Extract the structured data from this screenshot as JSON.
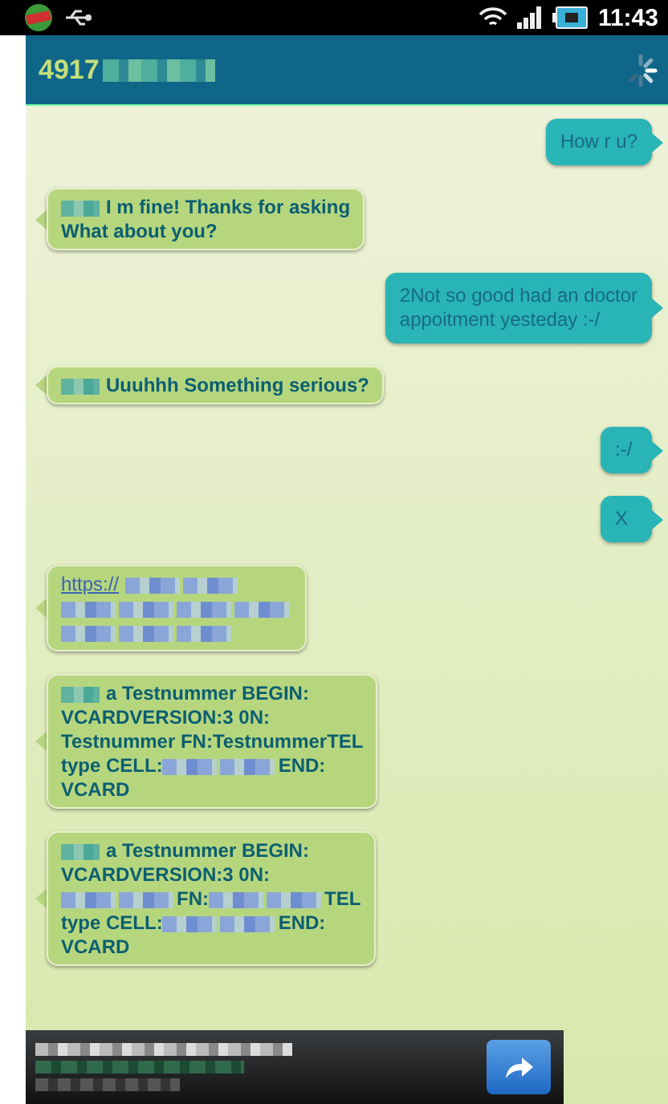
{
  "status_bar": {
    "time": "11:43"
  },
  "header": {
    "title": "4917",
    "title_redacted": true
  },
  "messages": [
    {
      "kind": "sent",
      "segments": [
        {
          "kind": "text",
          "text": "How r u?"
        }
      ]
    },
    {
      "kind": "received",
      "segments": [
        {
          "kind": "redacted"
        },
        {
          "kind": "text",
          "text": "I m fine! Thanks for asking"
        },
        {
          "kind": "break"
        },
        {
          "kind": "text",
          "text": "What about you?"
        }
      ]
    },
    {
      "kind": "sent",
      "segments": [
        {
          "kind": "text",
          "text": "2Not so good had an doctor"
        },
        {
          "kind": "break"
        },
        {
          "kind": "text",
          "text": "appoitment yesteday :-/"
        }
      ]
    },
    {
      "kind": "received",
      "segments": [
        {
          "kind": "redacted"
        },
        {
          "kind": "text",
          "text": "Uuuhhh Something serious?"
        }
      ]
    },
    {
      "kind": "sent",
      "segments": [
        {
          "kind": "text",
          "text": ":-/"
        }
      ]
    },
    {
      "kind": "sent",
      "segments": [
        {
          "kind": "text",
          "text": "X"
        }
      ]
    },
    {
      "kind": "received",
      "segments": [
        {
          "kind": "link",
          "text": "https://"
        },
        {
          "kind": "redacted"
        },
        {
          "kind": "redacted"
        },
        {
          "kind": "break"
        },
        {
          "kind": "redacted"
        },
        {
          "kind": "redacted"
        },
        {
          "kind": "redacted"
        },
        {
          "kind": "redacted"
        },
        {
          "kind": "break"
        },
        {
          "kind": "redacted"
        },
        {
          "kind": "redacted"
        },
        {
          "kind": "redacted"
        }
      ]
    },
    {
      "kind": "received",
      "segments": [
        {
          "kind": "redacted"
        },
        {
          "kind": "text",
          "text": "a Testnummer BEGIN:"
        },
        {
          "kind": "break"
        },
        {
          "kind": "text",
          "text": "VCARDVERSION:3 0N:"
        },
        {
          "kind": "break"
        },
        {
          "kind": "text",
          "text": "Testnummer FN:TestnummerTEL"
        },
        {
          "kind": "break"
        },
        {
          "kind": "text",
          "text": "type CELL:"
        },
        {
          "kind": "redacted"
        },
        {
          "kind": "redacted"
        },
        {
          "kind": "text",
          "text": "END:"
        },
        {
          "kind": "break"
        },
        {
          "kind": "text",
          "text": "VCARD"
        }
      ]
    },
    {
      "kind": "received",
      "segments": [
        {
          "kind": "redacted"
        },
        {
          "kind": "text",
          "text": "a Testnummer BEGIN:"
        },
        {
          "kind": "break"
        },
        {
          "kind": "text",
          "text": "VCARDVERSION:3 0N:"
        },
        {
          "kind": "break"
        },
        {
          "kind": "redacted"
        },
        {
          "kind": "redacted"
        },
        {
          "kind": "text",
          "text": "FN:"
        },
        {
          "kind": "redacted"
        },
        {
          "kind": "redacted"
        },
        {
          "kind": "text",
          "text": "TEL"
        },
        {
          "kind": "break"
        },
        {
          "kind": "text",
          "text": "type CELL:"
        },
        {
          "kind": "redacted"
        },
        {
          "kind": "redacted"
        },
        {
          "kind": "text",
          "text": "END:"
        },
        {
          "kind": "break"
        },
        {
          "kind": "text",
          "text": "VCARD"
        }
      ]
    }
  ],
  "notification": {
    "redacted": true
  }
}
